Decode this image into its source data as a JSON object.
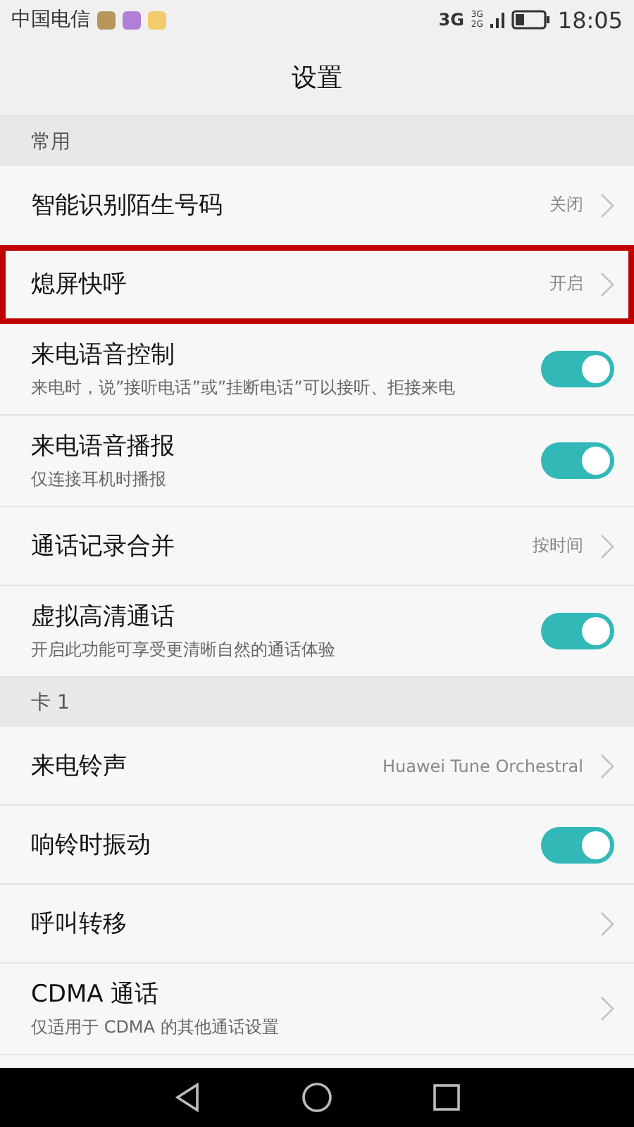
{
  "status_bar": {
    "carrier": "中国电信",
    "notifications": [
      {
        "color": "#b8965a"
      },
      {
        "color": "#b07fd8"
      },
      {
        "color": "#f2cc6a"
      }
    ],
    "network": "3G",
    "signal_labels": [
      "3G",
      "2G"
    ],
    "time": "18:05"
  },
  "title": "设置",
  "sections": [
    {
      "header": "常用",
      "rows": [
        {
          "kind": "link",
          "title": "智能识别陌生号码",
          "value": "关闭",
          "highlighted": false
        },
        {
          "kind": "link",
          "title": "熄屏快呼",
          "value": "开启",
          "highlighted": true
        },
        {
          "kind": "switch",
          "title": "来电语音控制",
          "subtitle": "来电时，说”接听电话”或”挂断电话”可以接听、拒接来电",
          "on": true,
          "highlighted": false
        },
        {
          "kind": "switch",
          "title": "来电语音播报",
          "subtitle": "仅连接耳机时播报",
          "on": true,
          "highlighted": false
        },
        {
          "kind": "link",
          "title": "通话记录合并",
          "value": "按时间",
          "highlighted": false
        },
        {
          "kind": "switch",
          "title": "虚拟高清通话",
          "subtitle": "开启此功能可享受更清晰自然的通话体验",
          "on": true,
          "highlighted": false
        }
      ]
    },
    {
      "header": "卡 1",
      "rows": [
        {
          "kind": "link",
          "title": "来电铃声",
          "value": "Huawei Tune Orchestral",
          "highlighted": false
        },
        {
          "kind": "switch",
          "title": "响铃时振动",
          "on": true,
          "highlighted": false
        },
        {
          "kind": "link",
          "title": "呼叫转移",
          "highlighted": false
        },
        {
          "kind": "link",
          "title": "CDMA 通话",
          "subtitle": "仅适用于 CDMA 的其他通话设置",
          "highlighted": false
        }
      ]
    }
  ]
}
